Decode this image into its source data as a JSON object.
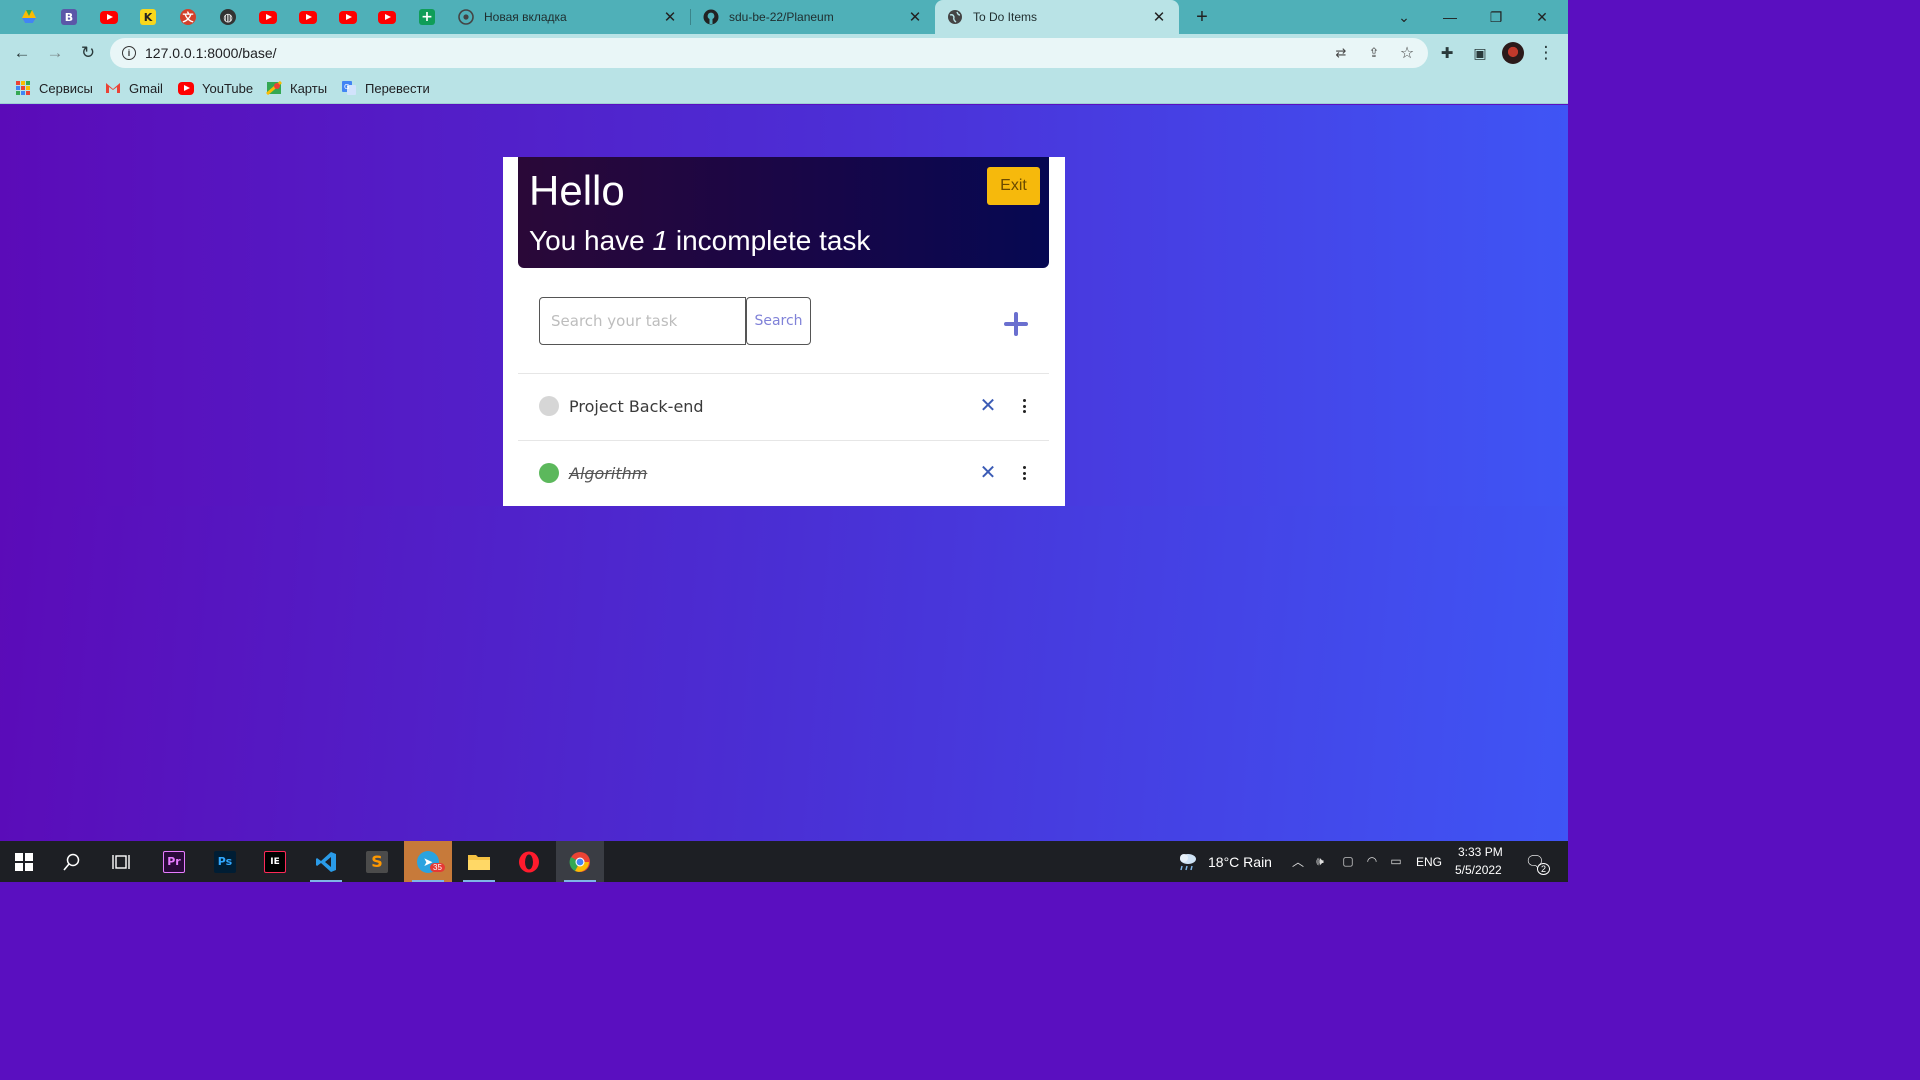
{
  "browser": {
    "tabs": [
      {
        "title": "Новая вкладка",
        "icon": "chrome-icon"
      },
      {
        "title": "sdu-be-22/Planeum",
        "icon": "github-icon"
      },
      {
        "title": "To Do Items",
        "icon": "globe-icon",
        "active": true
      }
    ],
    "pinned_tabs": [
      "drive-icon",
      "b-icon",
      "youtube-icon",
      "k-icon",
      "translate-icon",
      "globe-icon",
      "youtube-icon",
      "youtube-icon",
      "youtube-icon",
      "youtube-icon",
      "sheets-icon"
    ],
    "url": "127.0.0.1:8000/base/",
    "bookmarks": [
      {
        "label": "Сервисы",
        "icon": "apps-grid-icon"
      },
      {
        "label": "Gmail",
        "icon": "gmail-icon"
      },
      {
        "label": "YouTube",
        "icon": "youtube-icon"
      },
      {
        "label": "Карты",
        "icon": "maps-icon"
      },
      {
        "label": "Перевести",
        "icon": "translate-icon"
      }
    ]
  },
  "app": {
    "greeting": "Hello",
    "subtitle_prefix": "You have ",
    "incomplete_count": "1",
    "subtitle_suffix": " incomplete task",
    "exit_label": "Exit",
    "search_placeholder": "Search your task",
    "search_label": "Search",
    "tasks": [
      {
        "title": "Project Back-end",
        "complete": false
      },
      {
        "title": "Algorithm",
        "complete": true
      }
    ],
    "colors": {
      "accent": "#6a6fcf",
      "exit": "#f6b90c",
      "complete_dot": "#5cb85c",
      "incomplete_dot": "#d6d6d6"
    }
  },
  "taskbar": {
    "weather": "18°C  Rain",
    "language": "ENG",
    "time": "3:33 PM",
    "date": "5/5/2022",
    "notifications": "2",
    "telegram_badge": "35"
  }
}
